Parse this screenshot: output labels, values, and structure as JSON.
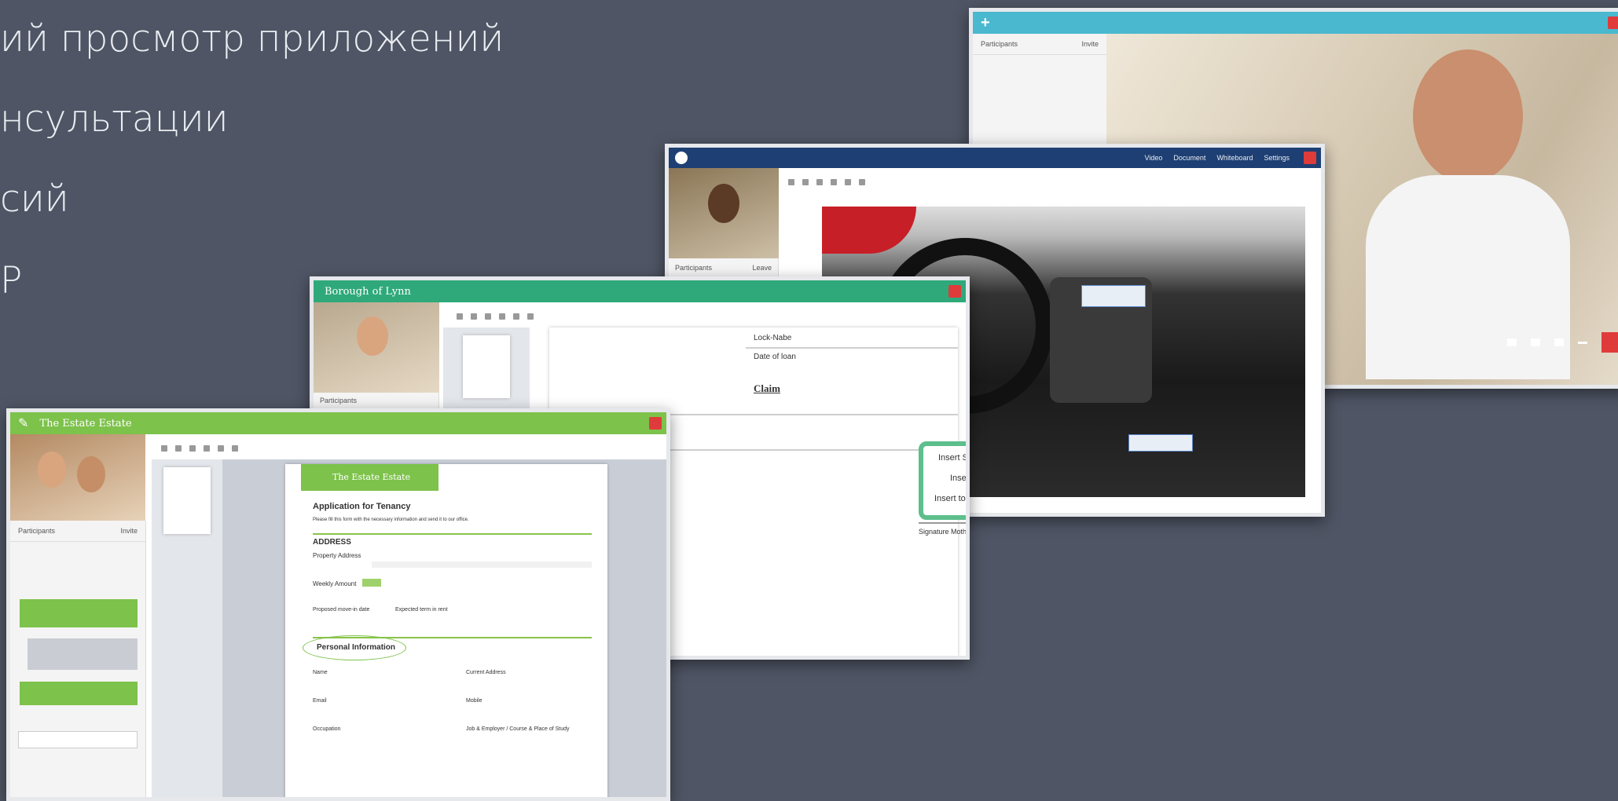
{
  "bullets": [
    "ий просмотр приложений",
    "нсультации",
    "сий",
    "Р"
  ],
  "window_a": {
    "title": "",
    "menu": [
      "",
      "",
      "",
      ""
    ],
    "sidebar": {
      "header": "Participants",
      "invite": "Invite",
      "items": [
        "",
        ""
      ]
    }
  },
  "window_b": {
    "title": "",
    "menu": [
      "Video",
      "Document",
      "Whiteboard",
      "Settings"
    ],
    "participants_label": "Participants",
    "leave_label": "Leave",
    "callouts": [
      "",
      ""
    ]
  },
  "window_c": {
    "title": "Borough of Lynn",
    "menu": [
      "",
      "",
      "",
      ""
    ],
    "participants_label": "Participants",
    "doc_rows": [
      "Lock-Nabe",
      "Date of loan"
    ],
    "doc_heading": "Claim",
    "signature_actions": [
      "Insert Signature",
      "Insert Text",
      "Insert today's Date"
    ],
    "signature_label": "Signature Mother"
  },
  "window_d": {
    "title": "The Estate Estate",
    "menu": [
      "",
      "",
      "",
      ""
    ],
    "sidebar": {
      "header": "Participants",
      "invite": "Invite",
      "items": [
        "",
        ""
      ]
    },
    "doc": {
      "brand": "The Estate Estate",
      "title": "Application for Tenancy",
      "intro": "Please fill this form with the necessary information and send it to our office.",
      "address_heading": "ADDRESS",
      "property_address": "Property Address",
      "weekly_amount": "Weekly Amount",
      "proposed_move": "Proposed move-in date",
      "expected_term": "Expected term in rent",
      "personal_heading": "Personal Information",
      "name": "Name",
      "current_address": "Current Address",
      "email": "Email",
      "mobile": "Mobile",
      "occupation": "Occupation",
      "employer": "Job & Employer / Course & Place of Study"
    }
  }
}
